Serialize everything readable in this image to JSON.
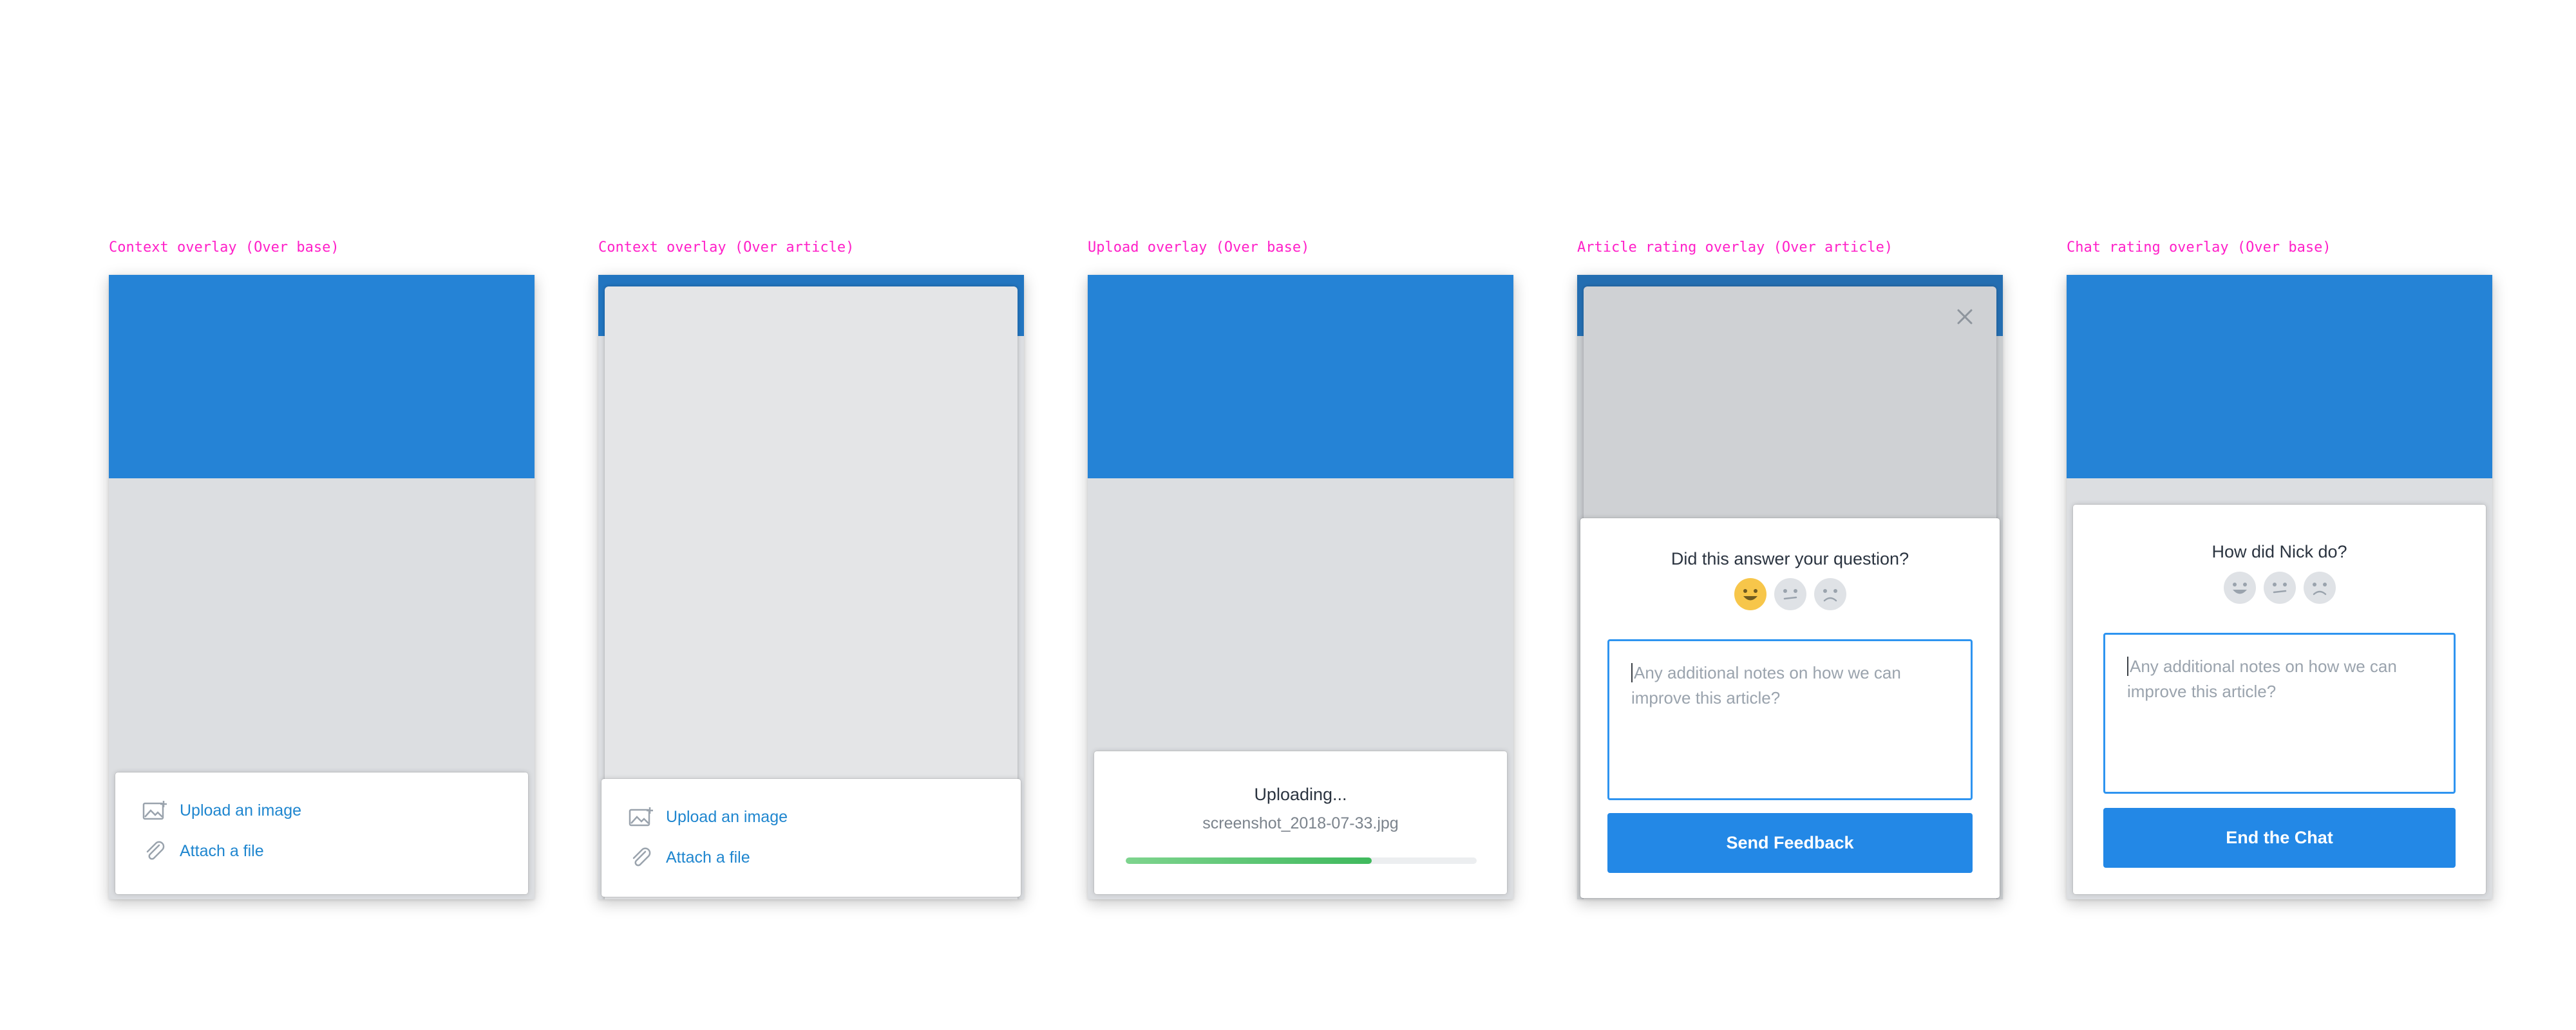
{
  "captions": [
    "Context overlay (Over base)",
    "Context overlay (Over article)",
    "Upload overlay (Over base)",
    "Article rating overlay (Over article)",
    "Chat rating overlay (Over base)"
  ],
  "context_menu": {
    "upload_image": "Upload an image",
    "attach_file": "Attach a file",
    "icons": [
      "image-plus-icon",
      "paperclip-icon"
    ]
  },
  "upload": {
    "title": "Uploading...",
    "filename": "screenshot_2018-07-33.jpg",
    "progress_percent": 70
  },
  "article_rating": {
    "question": "Did this answer your question?",
    "faces": [
      "happy",
      "neutral",
      "sad"
    ],
    "selected_face": "happy",
    "placeholder": "Any additional notes on how we can improve this article?",
    "button": "Send Feedback"
  },
  "chat_rating": {
    "question": "How did Nick do?",
    "faces": [
      "happy",
      "neutral",
      "sad"
    ],
    "placeholder": "Any additional notes on how we can improve this article?",
    "button": "End the Chat"
  },
  "colors": {
    "caption": "#ff1fc8",
    "header_blue": "#2583d6",
    "link_blue": "#1f86cf",
    "button_blue": "#2388e6",
    "progress_green": "#3fb95d",
    "face_selected": "#f7c64a",
    "face_idle": "#dfe2e6"
  }
}
